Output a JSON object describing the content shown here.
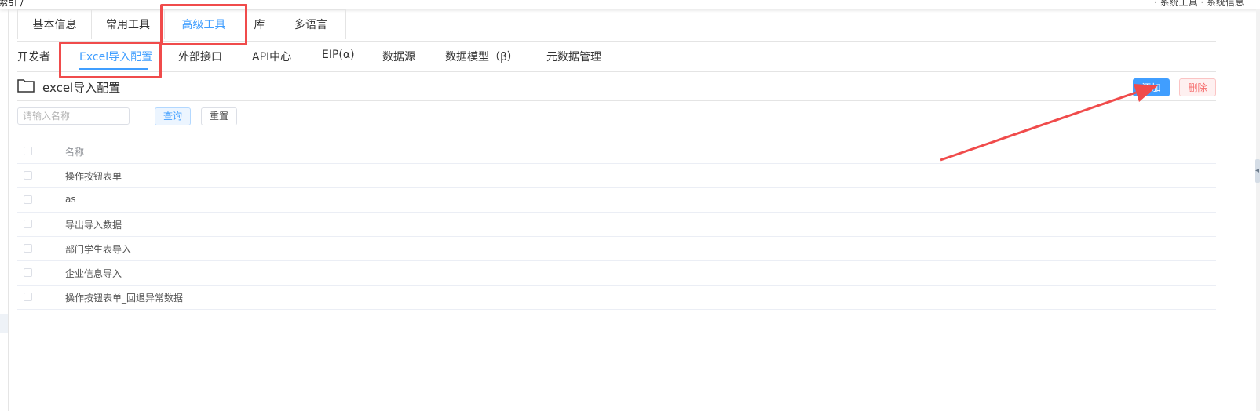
{
  "topbar": {
    "left_text": "索引 /",
    "right_text": "· 系统工具  · 系统信息"
  },
  "tabs_primary": [
    {
      "label": "基本信息"
    },
    {
      "label": "常用工具"
    },
    {
      "label": "高级工具"
    },
    {
      "label": "库"
    },
    {
      "label": "多语言"
    }
  ],
  "tabs_secondary": [
    {
      "label": "开发者"
    },
    {
      "label": "Excel导入配置"
    },
    {
      "label": "外部接口"
    },
    {
      "label": "API中心"
    },
    {
      "label": "EIP(α)"
    },
    {
      "label": "数据源"
    },
    {
      "label": "数据模型（β）"
    },
    {
      "label": "元数据管理"
    }
  ],
  "page": {
    "title": "excel导入配置",
    "add_label": "添加",
    "delete_label": "删除"
  },
  "search": {
    "placeholder": "请输入名称",
    "value": "",
    "query_label": "查询",
    "reset_label": "重置"
  },
  "table": {
    "header": "名称",
    "rows": [
      "操作按钮表单",
      "as",
      "导出导入数据",
      "部门学生表导入",
      "企业信息导入",
      "操作按钮表单_回退异常数据"
    ]
  },
  "colors": {
    "accent": "#409eff",
    "danger": "#f56c6c",
    "annotation": "#f04b4b"
  }
}
